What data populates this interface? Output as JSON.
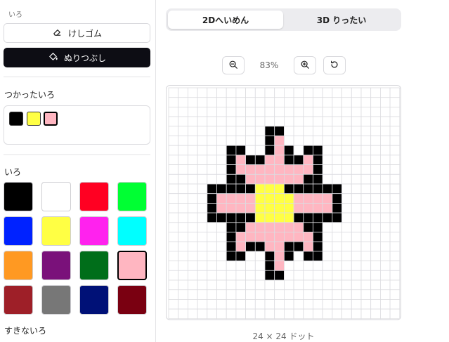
{
  "sidebar": {
    "top_label": "いろ",
    "eraser_label": "けしゴム",
    "fill_label": "ぬりつぶし",
    "used_colors_label": "つかったいろ",
    "used_colors": [
      "#000000",
      "#ffff44",
      "#ffb6c1"
    ],
    "used_selected_index": 2,
    "palette_label": "いろ",
    "palette": [
      "#000000",
      "#ffffff",
      "#ff0022",
      "#00ff33",
      "#0022ff",
      "#ffff44",
      "#ff22ee",
      "#00ffff",
      "#ff9922",
      "#7a117a",
      "#006e1a",
      "#ffb6c1",
      "#9e1f28",
      "#777777",
      "#001177",
      "#7a0011"
    ],
    "palette_selected_index": 11,
    "favorites_label": "すきないろ"
  },
  "mode": {
    "tab_2d": "2Dへいめん",
    "tab_3d": "3D りったい",
    "active": "2d"
  },
  "zoom": {
    "value": "83%"
  },
  "canvas": {
    "dimensions_label": "24 × 24 ドット",
    "grid_size": 24,
    "palette": {
      "B": "#000000",
      "P": "#ffb6c1",
      "Y": "#ffff44"
    },
    "rows": [
      "........................",
      "........................",
      "........................",
      "........................",
      "..........BB............",
      "..........BP............",
      "......BB..BPB.BB........",
      "......BPBBPPBBPB........",
      "......BPPPPPPPPB........",
      "......BBPPPPPPBB........",
      "....BBBBBYYYBBBBBB......",
      "....BPPPPYYYYPPPPB......",
      "....BPPPPYYYYPPPPB......",
      "....BBBBBYYYYBBBBB......",
      "......BBPPPPPPBB........",
      "......BPPPPPPPPB........",
      "......BPBBPPBBPB........",
      "......BB..BPB.BB........",
      "..........BP............",
      "..........BB............",
      "........................",
      "........................",
      "........................",
      "........................"
    ]
  }
}
